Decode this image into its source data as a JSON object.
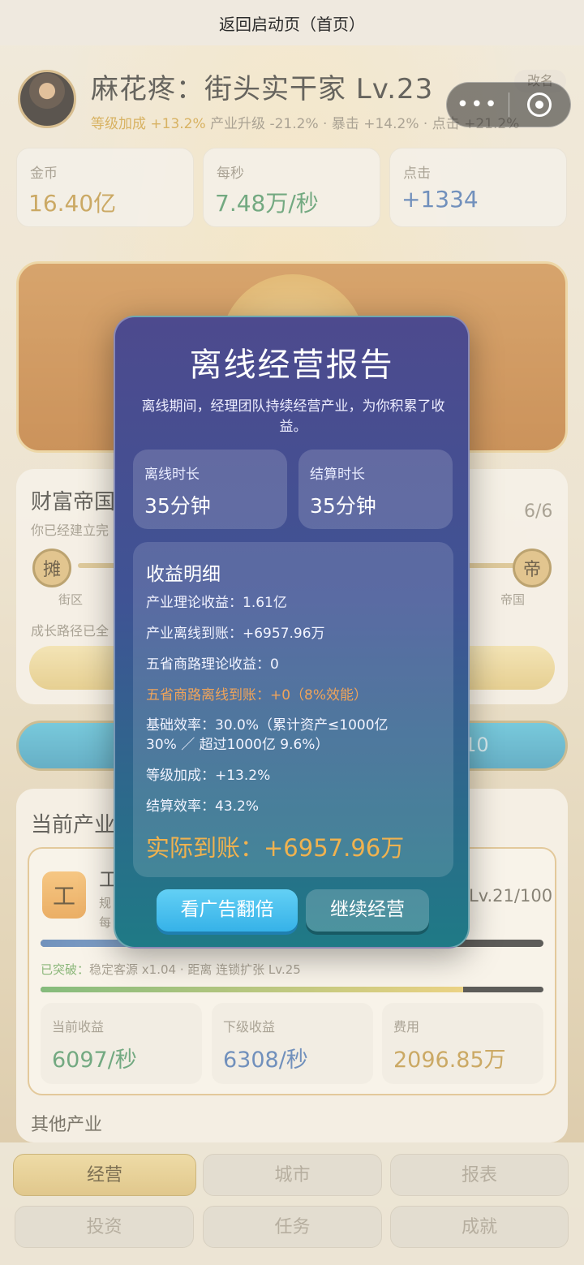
{
  "topbar": {
    "back_label": "返回启动页（首页）"
  },
  "profile": {
    "name": "麻花疼：街头实干家 Lv.23",
    "rename_label": "改名",
    "bonus_level": "等级加成 +13.2%",
    "bonus_rest": "产业升级 -21.2% · 暴击 +14.2% · 点击 +21.2%"
  },
  "stats": [
    {
      "label": "金币",
      "value": "16.40亿",
      "color": "#b8892f"
    },
    {
      "label": "每秒",
      "value": "7.48万/秒",
      "color": "#3e8a56"
    },
    {
      "label": "点击",
      "value": "+1334",
      "color": "#3b67a8"
    }
  ],
  "empire": {
    "title": "财富帝国",
    "subtitle": "你已经建立完",
    "count": "6/6",
    "start_node": "摊",
    "start_label": "街区",
    "end_node": "帝",
    "end_label": "帝国",
    "growth_text": "成长路径已全"
  },
  "blue_pill_text": "/10",
  "industry": {
    "title": "当前产业",
    "icon_char": "工",
    "name": "工",
    "sub1": "规",
    "sub2": "每",
    "level": "Lv.21/100",
    "progress": 0.72,
    "breakthrough_prefix": "已突破：",
    "breakthrough_text": "稳定客源 x1.04 · 距离 连锁扩张 Lv.25",
    "progress2": 0.84,
    "cards": [
      {
        "label": "当前收益",
        "value": "6097/秒",
        "color": "#3e8a56"
      },
      {
        "label": "下级收益",
        "value": "6308/秒",
        "color": "#3b67a8"
      },
      {
        "label": "费用",
        "value": "2096.85万",
        "color": "#b8892f"
      }
    ],
    "other_title": "其他产业"
  },
  "tabs": [
    {
      "label": "经营",
      "active": true
    },
    {
      "label": "城市",
      "active": false
    },
    {
      "label": "报表",
      "active": false
    },
    {
      "label": "投资",
      "active": false
    },
    {
      "label": "任务",
      "active": false
    },
    {
      "label": "成就",
      "active": false
    }
  ],
  "modal": {
    "title": "离线经营报告",
    "description": "离线期间，经理团队持续经营产业，为你积累了收益。",
    "offline_duration_label": "离线时长",
    "offline_duration_value": "35分钟",
    "settle_duration_label": "结算时长",
    "settle_duration_value": "35分钟",
    "detail_title": "收益明细",
    "lines": [
      "产业理论收益：1.61亿",
      "产业离线到账：+6957.96万",
      "五省商路理论收益：0",
      "五省商路离线到账：+0（8%效能）",
      "基础效率：30.0%（累计资产≤1000亿",
      "30% ／ 超过1000亿 9.6%）",
      "等级加成：+13.2%",
      "结算效率：43.2%"
    ],
    "total": "实际到账：+6957.96万",
    "ad_button": "看广告翻倍",
    "continue_button": "继续经营"
  }
}
